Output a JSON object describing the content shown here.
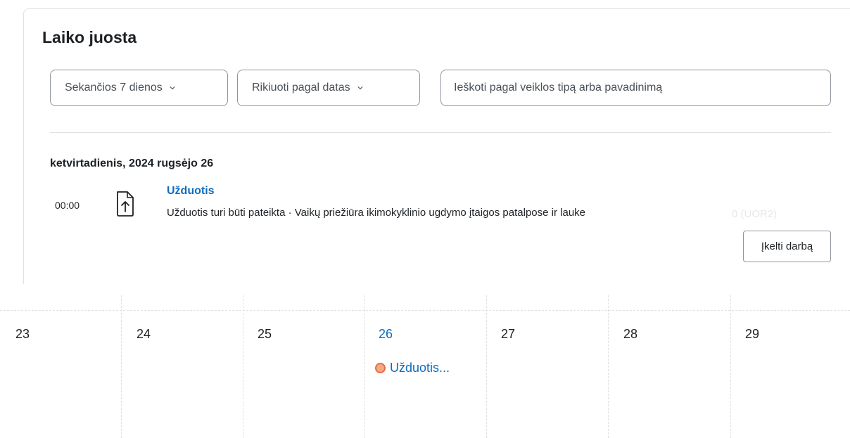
{
  "timeline": {
    "title": "Laiko juosta",
    "filter_days": "Sekančios 7 dienos",
    "sort_by": "Rikiuoti pagal datas",
    "search_placeholder": "Ieškoti pagal veiklos tipą arba pavadinimą",
    "date_heading": "ketvirtadienis, 2024 rugsėjo 26",
    "event": {
      "time": "00:00",
      "name": "Užduotis",
      "description": "Užduotis turi būti pateikta · Vaikų priežiūra ikimokyklinio ugdymo įtaigos patalpose ir lauke",
      "ghost_text": "0 (UOR2)",
      "action_label": "Įkelti darbą",
      "icon": "file-upload-icon"
    }
  },
  "calendar": {
    "days": [
      {
        "day": "23"
      },
      {
        "day": "24"
      },
      {
        "day": "25"
      },
      {
        "day": "26",
        "today": true
      },
      {
        "day": "27"
      },
      {
        "day": "28"
      },
      {
        "day": "29"
      }
    ],
    "event_label": "Užduotis...",
    "event_color": "#e46f3f",
    "today_color": "#0f6cbf"
  }
}
